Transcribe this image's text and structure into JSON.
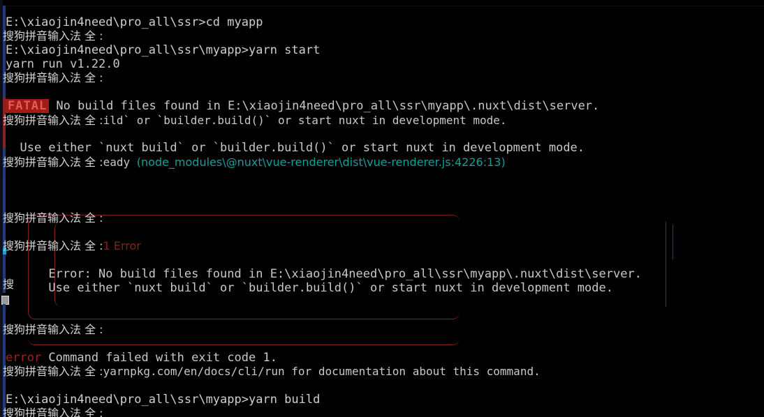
{
  "window": {
    "type": "windows-command-prompt",
    "background": "#000000",
    "foreground": "#cccccc"
  },
  "colors": {
    "fatal_badge_bg": "#a01c17",
    "fatal_badge_fg": "#e85a52",
    "error_red": "#a02020",
    "dim_red": "#8a1f1f",
    "box_border": "#7e1f1f",
    "path_teal": "#12a09a",
    "edge_red": "#9b2b28",
    "edge_blue": "#1f3b7a",
    "edge_cyan": "#1aa6c8"
  },
  "ime": {
    "name": "搜狗拼音输入法",
    "mode": "全",
    "separator": ":",
    "overlay_label": "搜狗拼音输入法 全 :",
    "partial_label": "搜"
  },
  "terminal": {
    "lines": [
      {
        "id": "l1",
        "kind": "command",
        "text": "E:\\xiaojin4need\\pro_all\\ssr>cd myapp"
      },
      {
        "id": "l2",
        "kind": "ime-overlay",
        "text": "搜狗拼音输入法 全 :",
        "tail": ""
      },
      {
        "id": "l3",
        "kind": "command",
        "text": "E:\\xiaojin4need\\pro_all\\ssr\\myapp>yarn start"
      },
      {
        "id": "l4",
        "kind": "output",
        "text": "yarn run v1.22.0"
      },
      {
        "id": "l5",
        "kind": "ime-overlay",
        "text": "搜狗拼音输入法 全 :",
        "tail": ""
      },
      {
        "id": "l6",
        "kind": "fatal",
        "badge": "FATAL",
        "text": " No build files found in E:\\xiaojin4need\\pro_all\\ssr\\myapp\\.nuxt\\dist\\server."
      },
      {
        "id": "l7",
        "kind": "ime-overlay",
        "text": "搜狗拼音输入法 全 :",
        "tail": "ild` or `builder.build()` or start nuxt in development mode."
      },
      {
        "id": "l8",
        "kind": "output",
        "text": "  Use either `nuxt build` or `builder.build()` or start nuxt in development mode."
      },
      {
        "id": "l9",
        "kind": "ime-overlay-path",
        "text": "搜狗拼音输入法 全 :",
        "tail": "eady ",
        "path": "(node_modules\\@nuxt\\vue-renderer\\dist\\vue-renderer.js:4226:13)"
      },
      {
        "id": "l10",
        "kind": "ime-overlay",
        "text": "搜狗拼音输入法 全 :",
        "tail": ""
      },
      {
        "id": "l11",
        "kind": "ime-overlay-err",
        "text": "搜狗拼音输入法 全 :",
        "tail": "1 Error"
      },
      {
        "id": "l12",
        "kind": "output",
        "text": "      Error: No build files found in E:\\xiaojin4need\\pro_all\\ssr\\myapp\\.nuxt\\dist\\server."
      },
      {
        "id": "l13",
        "kind": "output",
        "text": "      Use either `nuxt build` or `builder.build()` or start nuxt in development mode."
      },
      {
        "id": "l14",
        "kind": "ime-partial",
        "text": "搜"
      },
      {
        "id": "l15",
        "kind": "ime-overlay",
        "text": "搜狗拼音输入法 全 :",
        "tail": ""
      },
      {
        "id": "l16",
        "kind": "yarn-error",
        "badge": "error",
        "text": " Command failed with exit code 1."
      },
      {
        "id": "l17",
        "kind": "ime-overlay",
        "text": "搜狗拼音输入法 全 :",
        "tail": "yarnpkg.com/en/docs/cli/run for documentation about this command."
      },
      {
        "id": "l18",
        "kind": "command",
        "text": "E:\\xiaojin4need\\pro_all\\ssr\\myapp>yarn build"
      },
      {
        "id": "l19",
        "kind": "ime-overlay",
        "text": "搜狗拼音输入法 全 :",
        "tail": ""
      }
    ],
    "fatal_badge": "FATAL",
    "yarn_error_badge": "error",
    "error_count_label": "1 Error",
    "renderer_path": "(node_modules\\@nuxt\\vue-renderer\\dist\\vue-renderer.js:4226:13)"
  }
}
